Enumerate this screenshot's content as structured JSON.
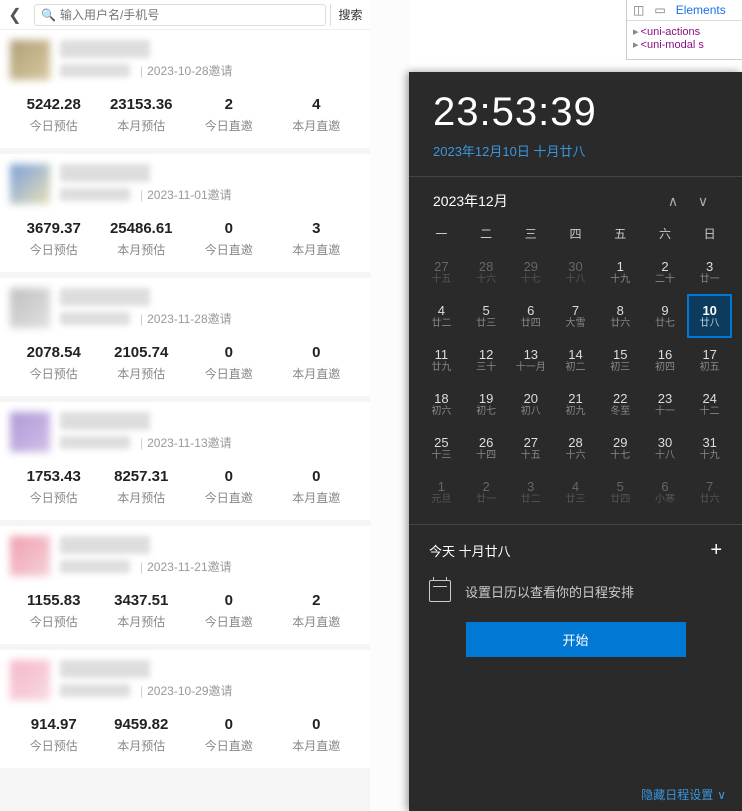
{
  "search": {
    "placeholder": "输入用户名/手机号",
    "button": "搜索"
  },
  "stat_labels": {
    "today_est": "今日预估",
    "month_est": "本月预估",
    "today_invite": "今日直邀",
    "month_invite": "本月直邀"
  },
  "users": [
    {
      "invite": "2023-10-28邀请",
      "today_est": "5242.28",
      "month_est": "23153.36",
      "today_inv": "2",
      "month_inv": "4"
    },
    {
      "invite": "2023-11-01邀请",
      "today_est": "3679.37",
      "month_est": "25486.61",
      "today_inv": "0",
      "month_inv": "3"
    },
    {
      "invite": "2023-11-28邀请",
      "today_est": "2078.54",
      "month_est": "2105.74",
      "today_inv": "0",
      "month_inv": "0"
    },
    {
      "invite": "2023-11-13邀请",
      "today_est": "1753.43",
      "month_est": "8257.31",
      "today_inv": "0",
      "month_inv": "0"
    },
    {
      "invite": "2023-11-21邀请",
      "today_est": "1155.83",
      "month_est": "3437.51",
      "today_inv": "0",
      "month_inv": "2"
    },
    {
      "invite": "2023-10-29邀请",
      "today_est": "914.97",
      "month_est": "9459.82",
      "today_inv": "0",
      "month_inv": "0"
    }
  ],
  "devtools": {
    "tabs": {
      "elements": "Elements"
    },
    "lines": {
      "l1": "<uni-actions",
      "l2": "<uni-modal s"
    },
    "arrow": "▸"
  },
  "clock": {
    "time": "23:53:39",
    "date": "2023年12月10日 十月廿八"
  },
  "calendar": {
    "month": "2023年12月",
    "weekdays": [
      "一",
      "二",
      "三",
      "四",
      "五",
      "六",
      "日"
    ],
    "weeks": [
      [
        {
          "d": "27",
          "l": "十五",
          "o": true
        },
        {
          "d": "28",
          "l": "十六",
          "o": true
        },
        {
          "d": "29",
          "l": "十七",
          "o": true
        },
        {
          "d": "30",
          "l": "十八",
          "o": true
        },
        {
          "d": "1",
          "l": "十九"
        },
        {
          "d": "2",
          "l": "二十"
        },
        {
          "d": "3",
          "l": "廿一"
        }
      ],
      [
        {
          "d": "4",
          "l": "廿二"
        },
        {
          "d": "5",
          "l": "廿三"
        },
        {
          "d": "6",
          "l": "廿四"
        },
        {
          "d": "7",
          "l": "大雪"
        },
        {
          "d": "8",
          "l": "廿六"
        },
        {
          "d": "9",
          "l": "廿七"
        },
        {
          "d": "10",
          "l": "廿八",
          "t": true
        }
      ],
      [
        {
          "d": "11",
          "l": "廿九"
        },
        {
          "d": "12",
          "l": "三十"
        },
        {
          "d": "13",
          "l": "十一月"
        },
        {
          "d": "14",
          "l": "初二"
        },
        {
          "d": "15",
          "l": "初三"
        },
        {
          "d": "16",
          "l": "初四"
        },
        {
          "d": "17",
          "l": "初五"
        }
      ],
      [
        {
          "d": "18",
          "l": "初六"
        },
        {
          "d": "19",
          "l": "初七"
        },
        {
          "d": "20",
          "l": "初八"
        },
        {
          "d": "21",
          "l": "初九"
        },
        {
          "d": "22",
          "l": "冬至"
        },
        {
          "d": "23",
          "l": "十一"
        },
        {
          "d": "24",
          "l": "十二"
        }
      ],
      [
        {
          "d": "25",
          "l": "十三"
        },
        {
          "d": "26",
          "l": "十四"
        },
        {
          "d": "27",
          "l": "十五"
        },
        {
          "d": "28",
          "l": "十六"
        },
        {
          "d": "29",
          "l": "十七"
        },
        {
          "d": "30",
          "l": "十八"
        },
        {
          "d": "31",
          "l": "十九"
        }
      ],
      [
        {
          "d": "1",
          "l": "元旦",
          "o": true
        },
        {
          "d": "2",
          "l": "廿一",
          "o": true
        },
        {
          "d": "3",
          "l": "廿二",
          "o": true
        },
        {
          "d": "4",
          "l": "廿三",
          "o": true
        },
        {
          "d": "5",
          "l": "廿四",
          "o": true
        },
        {
          "d": "6",
          "l": "小寒",
          "o": true
        },
        {
          "d": "7",
          "l": "廿六",
          "o": true
        }
      ]
    ]
  },
  "agenda": {
    "today": "今天 十月廿八",
    "msg": "设置日历以查看你的日程安排",
    "start": "开始",
    "hide": "隐藏日程设置"
  }
}
